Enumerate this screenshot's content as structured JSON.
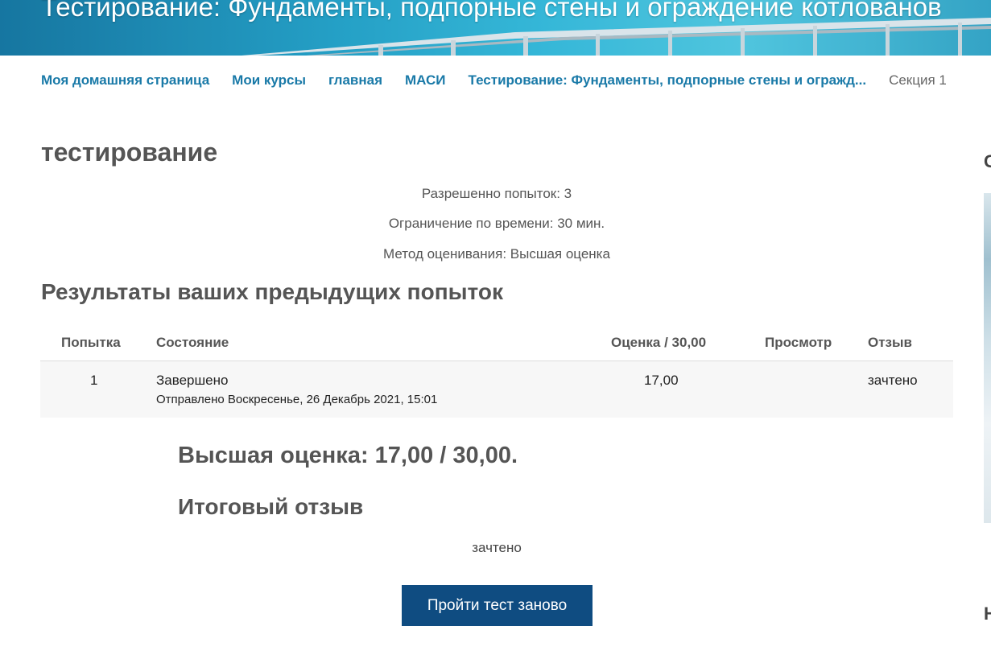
{
  "header": {
    "title": "Тестирование: Фундаменты, подпорные стены и ограждение котлованов"
  },
  "breadcrumb": {
    "items": [
      "Моя домашняя страница",
      "Мои курсы",
      "главная",
      "МАСИ",
      "Тестирование: Фундаменты, подпорные стены и огражд..."
    ],
    "current": "Секция 1"
  },
  "page": {
    "title": "тестирование",
    "info": {
      "attempts_allowed": "Разрешенно попыток: 3",
      "time_limit": "Ограничение по времени: 30 мин.",
      "grading_method": "Метод оценивания: Высшая оценка"
    }
  },
  "results": {
    "heading": "Результаты ваших предыдущих попыток",
    "columns": {
      "attempt": "Попытка",
      "state": "Состояние",
      "grade": "Оценка / 30,00",
      "review": "Просмотр",
      "feedback": "Отзыв"
    },
    "rows": [
      {
        "attempt": "1",
        "state": "Завершено",
        "submitted": "Отправлено Воскресенье, 26 Декабрь 2021, 15:01",
        "grade": "17,00",
        "review": "",
        "feedback": "зачтено"
      }
    ]
  },
  "summary": {
    "highest_grade": "Высшая оценка: 17,00 / 30,00.",
    "overall_feedback_heading": "Итоговый отзыв",
    "overall_feedback": "зачтено"
  },
  "actions": {
    "retry_label": "Пройти тест заново"
  },
  "sidebar": {
    "block1_initial": "С",
    "block2_initial": "Н"
  },
  "colors": {
    "link": "#1a7aa8",
    "button": "#0f4c81",
    "banner": "#1a9cc4"
  }
}
